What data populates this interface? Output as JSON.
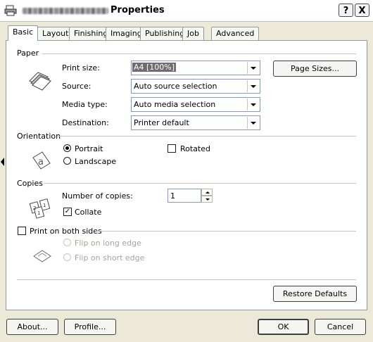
{
  "window": {
    "title": "Properties",
    "help_label": "?",
    "close_label": "X"
  },
  "tabs": [
    {
      "label": "Basic"
    },
    {
      "label": "Layout"
    },
    {
      "label": "Finishing"
    },
    {
      "label": "Imaging"
    },
    {
      "label": "Publishing"
    },
    {
      "label": "Job"
    },
    {
      "label": "Advanced"
    }
  ],
  "paper": {
    "group_label": "Paper",
    "print_size_label": "Print size:",
    "print_size_value": "A4  [100%]",
    "source_label": "Source:",
    "source_value": "Auto source selection",
    "media_type_label": "Media type:",
    "media_type_value": "Auto media selection",
    "destination_label": "Destination:",
    "destination_value": "Printer default",
    "page_sizes_button": "Page Sizes..."
  },
  "orientation": {
    "group_label": "Orientation",
    "portrait_label": "Portrait",
    "landscape_label": "Landscape",
    "rotated_label": "Rotated"
  },
  "copies": {
    "group_label": "Copies",
    "number_label": "Number of copies:",
    "number_value": "1",
    "collate_label": "Collate"
  },
  "duplex": {
    "print_both_sides_label": "Print on both sides",
    "flip_long_label": "Flip on long edge",
    "flip_short_label": "Flip on short edge"
  },
  "buttons": {
    "restore_defaults": "Restore Defaults",
    "about": "About...",
    "profile": "Profile...",
    "ok": "OK",
    "cancel": "Cancel"
  }
}
